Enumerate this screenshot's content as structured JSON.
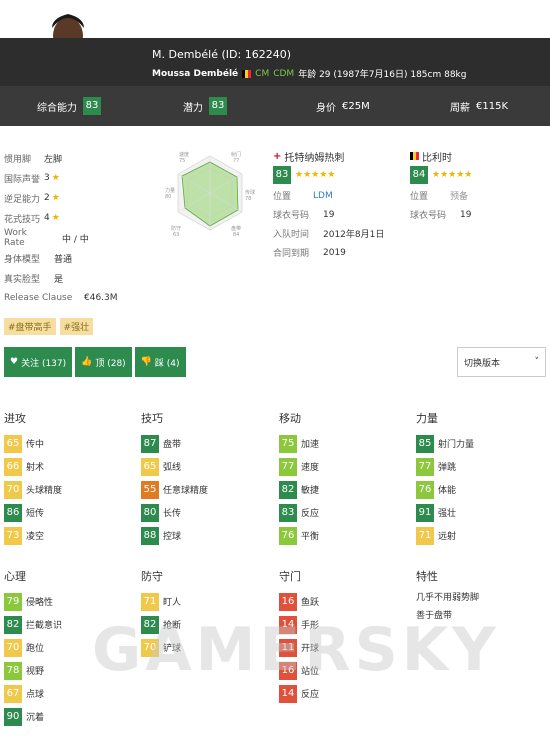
{
  "header": {
    "name_id": "M. Dembélé (ID: 162240)",
    "full_name": "Moussa Dembélé",
    "positions": [
      "CM",
      "CDM"
    ],
    "age_info": "年龄 29 (1987年7月16日) 185cm 88kg"
  },
  "stats": [
    {
      "label": "综合能力",
      "value": "83"
    },
    {
      "label": "潜力",
      "value": "83"
    },
    {
      "label": "身价",
      "value": "€25M"
    },
    {
      "label": "周薪",
      "value": "€115K"
    }
  ],
  "info": [
    {
      "k": "惯用脚",
      "v": "左脚",
      "stars": ""
    },
    {
      "k": "国际声誉",
      "v": "3",
      "stars": "★"
    },
    {
      "k": "逆足能力",
      "v": "2",
      "stars": "★"
    },
    {
      "k": "花式技巧",
      "v": "4",
      "stars": "★"
    },
    {
      "k": "Work Rate",
      "v": "中 / 中",
      "stars": ""
    },
    {
      "k": "身体模型",
      "v": "普通",
      "stars": ""
    },
    {
      "k": "真实脸型",
      "v": "是",
      "stars": ""
    },
    {
      "k": "Release Clause",
      "v": "€46.3M",
      "stars": ""
    }
  ],
  "radar": {
    "labels": [
      "速度",
      "射门",
      "传球",
      "盘带",
      "防守",
      "力量"
    ],
    "values": [
      "75",
      "77",
      "78",
      "84",
      "63",
      "80"
    ]
  },
  "club": {
    "name": "托特纳姆热刺",
    "rating": "83",
    "stars": "★★★★★",
    "rows": [
      {
        "k": "位置",
        "v": "LDM"
      },
      {
        "k": "球衣号码",
        "v": "19"
      },
      {
        "k": "入队时间",
        "v": "2012年8月1日"
      },
      {
        "k": "合同到期",
        "v": "2019"
      }
    ]
  },
  "nation": {
    "name": "比利时",
    "rating": "84",
    "stars": "★★★★★",
    "rows": [
      {
        "k": "位置",
        "v": "预备"
      },
      {
        "k": "球衣号码",
        "v": "19"
      }
    ]
  },
  "tags": [
    "#盘带高手",
    "#强壮"
  ],
  "actions": {
    "follow": "关注 (137)",
    "up": "顶 (28)",
    "down": "踩 (4)"
  },
  "version": {
    "label": "切换版本",
    "arrow": "˅"
  },
  "groups": [
    {
      "title": "进攻",
      "items": [
        {
          "v": "65",
          "l": "传中"
        },
        {
          "v": "66",
          "l": "射术"
        },
        {
          "v": "70",
          "l": "头球精度"
        },
        {
          "v": "86",
          "l": "短传"
        },
        {
          "v": "73",
          "l": "凌空"
        }
      ]
    },
    {
      "title": "技巧",
      "items": [
        {
          "v": "87",
          "l": "盘带"
        },
        {
          "v": "65",
          "l": "弧线"
        },
        {
          "v": "55",
          "l": "任意球精度"
        },
        {
          "v": "80",
          "l": "长传"
        },
        {
          "v": "88",
          "l": "控球"
        }
      ]
    },
    {
      "title": "移动",
      "items": [
        {
          "v": "75",
          "l": "加速"
        },
        {
          "v": "77",
          "l": "速度"
        },
        {
          "v": "82",
          "l": "敏捷"
        },
        {
          "v": "83",
          "l": "反应"
        },
        {
          "v": "76",
          "l": "平衡"
        }
      ]
    },
    {
      "title": "力量",
      "items": [
        {
          "v": "85",
          "l": "射门力量"
        },
        {
          "v": "77",
          "l": "弹跳"
        },
        {
          "v": "76",
          "l": "体能"
        },
        {
          "v": "91",
          "l": "强壮"
        },
        {
          "v": "71",
          "l": "远射"
        }
      ]
    },
    {
      "title": "心理",
      "items": [
        {
          "v": "79",
          "l": "侵略性"
        },
        {
          "v": "82",
          "l": "拦截意识"
        },
        {
          "v": "70",
          "l": "跑位"
        },
        {
          "v": "78",
          "l": "视野"
        },
        {
          "v": "67",
          "l": "点球"
        },
        {
          "v": "90",
          "l": "沉着"
        }
      ]
    },
    {
      "title": "防守",
      "items": [
        {
          "v": "71",
          "l": "盯人"
        },
        {
          "v": "82",
          "l": "抢断"
        },
        {
          "v": "70",
          "l": "铲球"
        }
      ]
    },
    {
      "title": "守门",
      "items": [
        {
          "v": "16",
          "l": "鱼跃"
        },
        {
          "v": "14",
          "l": "手形"
        },
        {
          "v": "11",
          "l": "开球"
        },
        {
          "v": "16",
          "l": "站位"
        },
        {
          "v": "14",
          "l": "反应"
        }
      ]
    }
  ],
  "traits": {
    "title": "特性",
    "items": [
      "几乎不用弱势脚",
      "善于盘带"
    ]
  },
  "watermark": "GAMERSKY"
}
